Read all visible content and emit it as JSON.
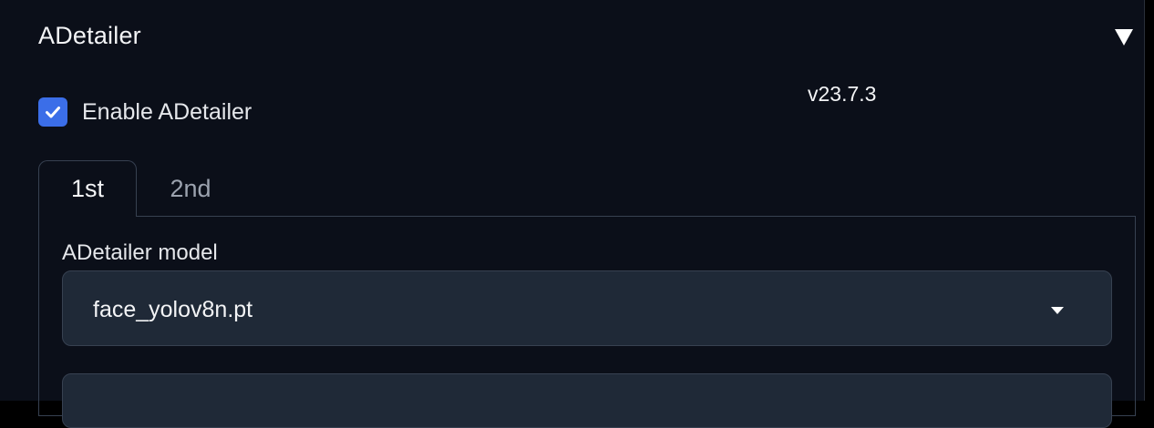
{
  "accordion": {
    "title": "ADetailer",
    "toggle_icon": "triangle-down-icon"
  },
  "enable": {
    "label": "Enable ADetailer",
    "checked": true
  },
  "version": "v23.7.3",
  "tabs": [
    {
      "label": "1st",
      "selected": true
    },
    {
      "label": "2nd",
      "selected": false
    }
  ],
  "model": {
    "label": "ADetailer model",
    "value": "face_yolov8n.pt",
    "caret_icon": "chevron-down-icon"
  },
  "colors": {
    "background": "#0b0f19",
    "accent": "#3b6ee8",
    "input_background": "#1f2937",
    "border": "#374151"
  }
}
